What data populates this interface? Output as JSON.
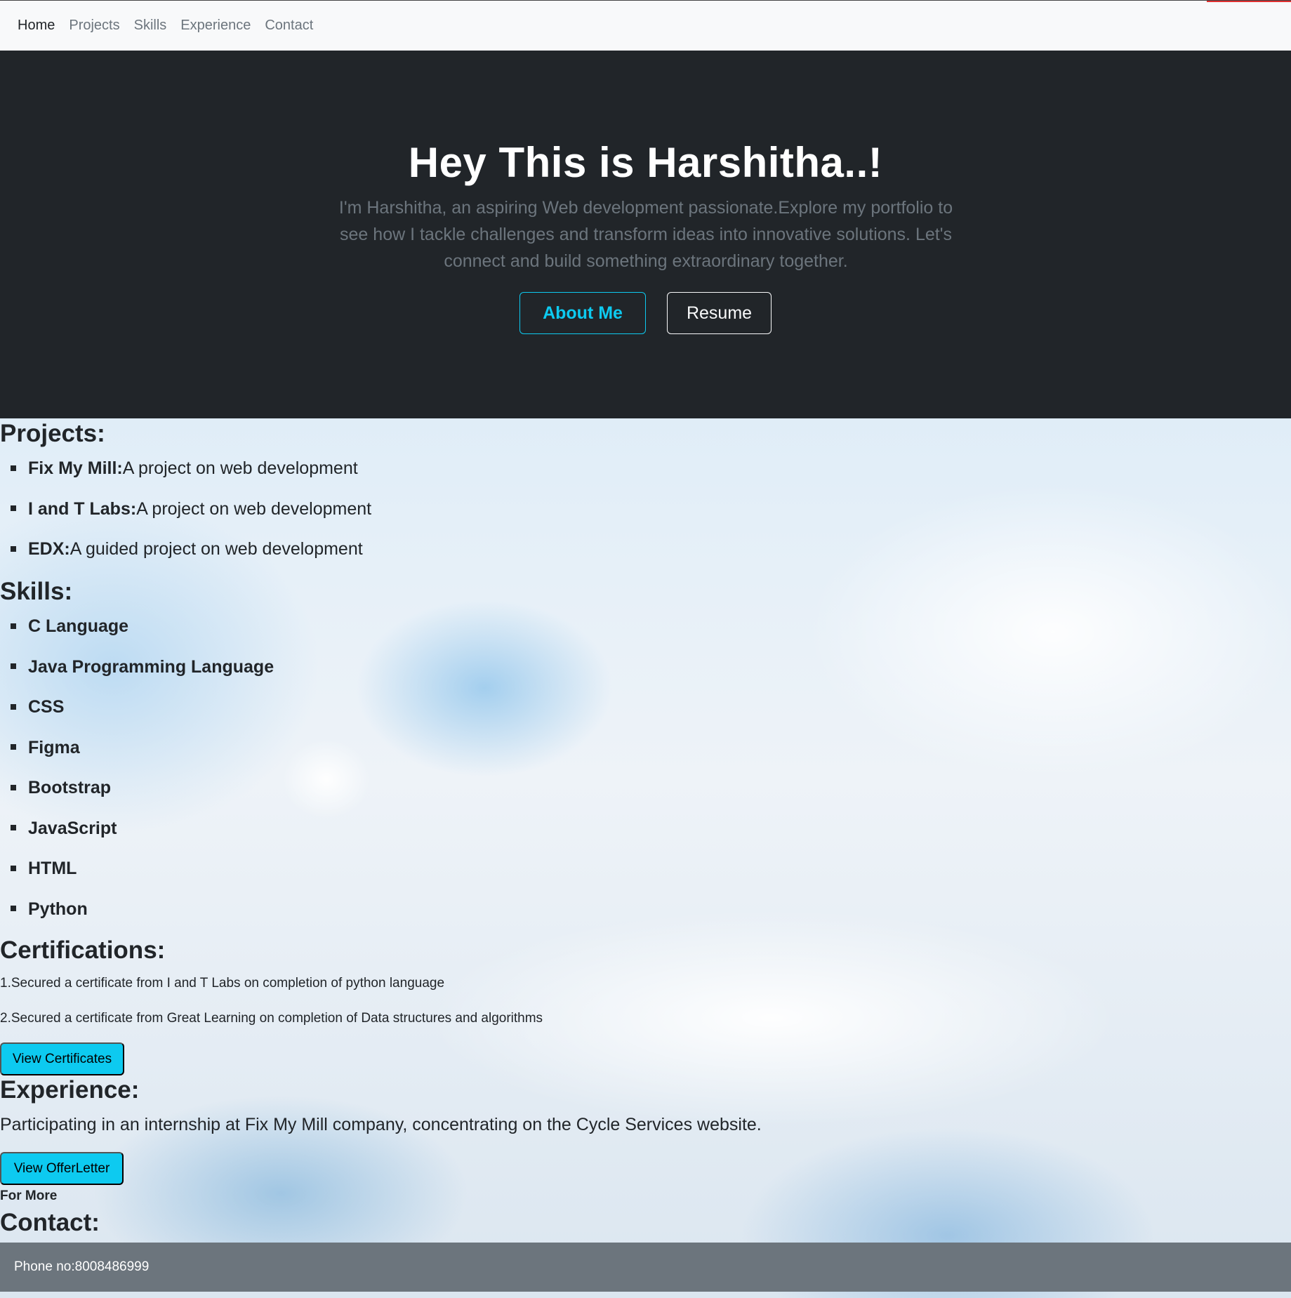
{
  "nav": {
    "items": [
      {
        "label": "Home"
      },
      {
        "label": "Projects"
      },
      {
        "label": "Skills"
      },
      {
        "label": "Experience"
      },
      {
        "label": "Contact"
      }
    ]
  },
  "hero": {
    "title": "Hey This is Harshitha..!",
    "subtitle": "I'm Harshitha, an aspiring Web development passionate.Explore my portfolio to see how I tackle challenges and transform ideas into innovative solutions. Let's connect and build something extraordinary together.",
    "about_label": "About Me",
    "resume_label": "Resume"
  },
  "projects": {
    "heading": "Projects:",
    "items": [
      {
        "name": "Fix My Mill:",
        "desc": "A project on web development"
      },
      {
        "name": "I and T Labs:",
        "desc": "A project on web development"
      },
      {
        "name": "EDX:",
        "desc": "A guided project on web development"
      }
    ]
  },
  "skills": {
    "heading": "Skills:",
    "items": [
      "C Language",
      "Java Programming Language",
      "CSS",
      "Figma",
      "Bootstrap",
      "JavaScript",
      "HTML",
      "Python"
    ]
  },
  "certifications": {
    "heading": "Certifications:",
    "items": [
      "1.Secured a certificate from I and T Labs on completion of python language",
      "2.Secured a certificate from Great Learning on completion of Data structures and algorithms"
    ],
    "button_label": "View Certificates"
  },
  "experience": {
    "heading": "Experience:",
    "text": "Participating in an internship at Fix My Mill company, concentrating on the Cycle Services website.",
    "button_label": "View OfferLetter",
    "for_more": "For More"
  },
  "contact": {
    "heading": "Contact:",
    "phone": "Phone no:8008486999"
  },
  "colors": {
    "hero_bg": "#212529",
    "accent": "#0dcaf0",
    "footer_bg": "#6c757d",
    "navbar_bg": "#f8f9fa"
  }
}
